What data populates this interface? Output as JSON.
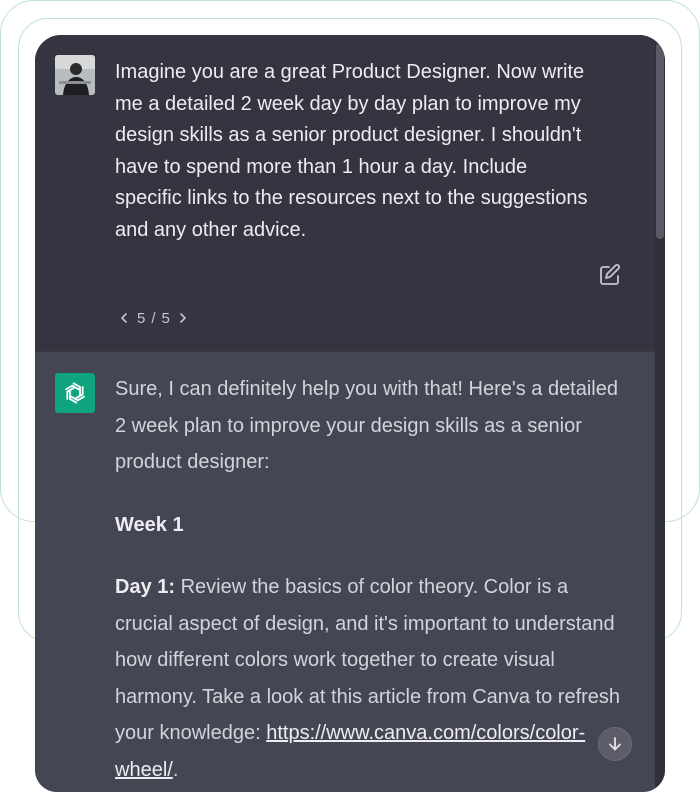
{
  "conversation": {
    "user_message": "Imagine you are a great Product Designer. Now write\nme a detailed 2 week day by day plan to improve my\ndesign skills as a senior product designer. I shouldn't\nhave to spend more than 1 hour a day. Include\nspecific links to the resources next to the suggestions\nand any other advice.",
    "pager": {
      "current": "5",
      "separator": "/",
      "total": "5"
    },
    "assistant": {
      "intro": "Sure, I can definitely help you with that! Here's a detailed 2 week plan to improve your design skills as a senior product designer:",
      "week_heading": "Week 1",
      "day_label": "Day 1:",
      "day_text": " Review the basics of color theory. Color is a crucial aspect of design, and it's important to understand how different colors work together to create visual harmony. Take a look at this article from Canva to refresh your knowledge: ",
      "link_text": "https://www.canva.com/colors/color-wheel/",
      "link_suffix": "."
    }
  },
  "icons": {
    "avatar": "user-avatar",
    "edit": "edit-icon",
    "prev": "chevron-left-icon",
    "next": "chevron-right-icon",
    "assistant_logo": "openai-logo-icon",
    "scroll": "arrow-down-icon"
  },
  "colors": {
    "user_bg": "#343541",
    "assistant_bg": "#444654",
    "logo_bg": "#10a37f",
    "outline": "#bfe3d3"
  }
}
